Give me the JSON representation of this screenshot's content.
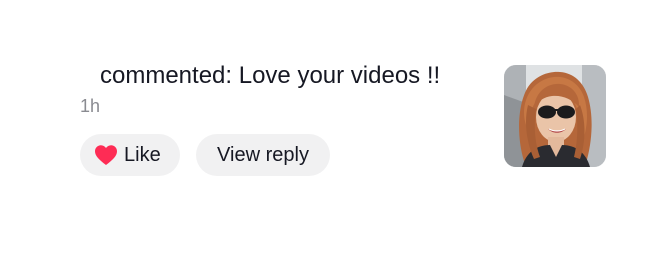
{
  "comment": {
    "text": "commented: Love your videos !!",
    "time": "1h"
  },
  "actions": {
    "like_label": "Like",
    "view_reply_label": "View reply"
  },
  "colors": {
    "heart": "#fe2c55",
    "pill_bg": "#f1f1f2",
    "text": "#161823",
    "muted": "#8a8b91"
  },
  "icons": {
    "like": "heart-icon"
  }
}
